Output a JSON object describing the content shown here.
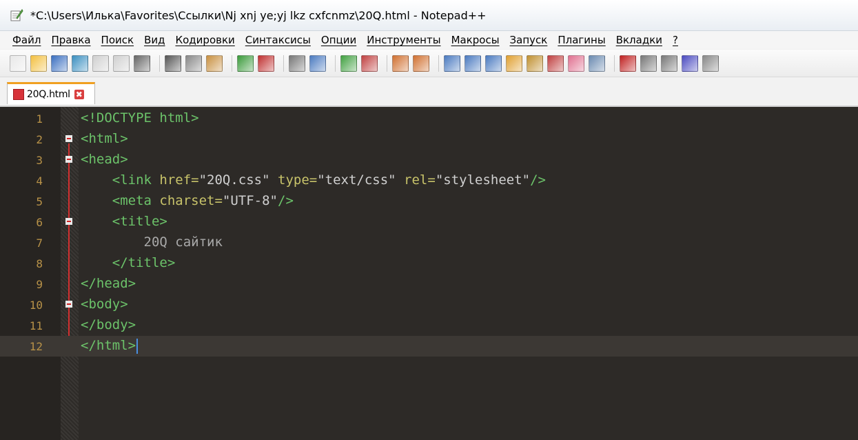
{
  "window": {
    "title": "*C:\\Users\\Илька\\Favorites\\Ссылки\\Nj xnj ye;yj lkz cxfcnmz\\20Q.html - Notepad++"
  },
  "menu": [
    "Файл",
    "Правка",
    "Поиск",
    "Вид",
    "Кодировки",
    "Синтаксисы",
    "Опции",
    "Инструменты",
    "Макросы",
    "Запуск",
    "Плагины",
    "Вкладки",
    "?"
  ],
  "toolbar_icons": [
    "new-file-icon",
    "open-file-icon",
    "save-icon",
    "save-all-icon",
    "close-icon",
    "close-all-icon",
    "print-icon",
    "cut-icon",
    "copy-icon",
    "paste-icon",
    "undo-icon",
    "redo-icon",
    "find-icon",
    "replace-icon",
    "zoom-in-icon",
    "zoom-out-icon",
    "sync-vertical-icon",
    "sync-horizontal-icon",
    "word-wrap-icon",
    "show-all-chars-icon",
    "indent-guide-icon",
    "udl-icon",
    "doc-map-icon",
    "function-list-icon",
    "folder-workspace-icon",
    "monitor-icon",
    "record-macro-icon",
    "stop-macro-icon",
    "play-macro-icon",
    "run-macro-multiple-icon",
    "save-macro-icon"
  ],
  "tab": {
    "label": "20Q.html",
    "close": "✖"
  },
  "editor": {
    "lines": [
      {
        "num": "1",
        "fold": false,
        "parts": [
          [
            "tag",
            "<!DOCTYPE html>"
          ]
        ]
      },
      {
        "num": "2",
        "fold": true,
        "parts": [
          [
            "tag",
            "<html>"
          ]
        ]
      },
      {
        "num": "3",
        "fold": true,
        "parts": [
          [
            "tag",
            "<head>"
          ]
        ]
      },
      {
        "num": "4",
        "fold": false,
        "parts": [
          [
            "txt",
            "    "
          ],
          [
            "tag",
            "<link "
          ],
          [
            "attr",
            "href="
          ],
          [
            "val",
            "\"20Q.css\" "
          ],
          [
            "attr",
            "type="
          ],
          [
            "val",
            "\"text/css\" "
          ],
          [
            "attr",
            "rel="
          ],
          [
            "val",
            "\"stylesheet\""
          ],
          [
            "tag",
            "/>"
          ]
        ]
      },
      {
        "num": "5",
        "fold": false,
        "parts": [
          [
            "txt",
            "    "
          ],
          [
            "tag",
            "<meta "
          ],
          [
            "attr",
            "charset="
          ],
          [
            "val",
            "\"UTF-8\""
          ],
          [
            "tag",
            "/>"
          ]
        ]
      },
      {
        "num": "6",
        "fold": true,
        "parts": [
          [
            "txt",
            "    "
          ],
          [
            "tag",
            "<title>"
          ]
        ]
      },
      {
        "num": "7",
        "fold": false,
        "parts": [
          [
            "txt",
            "        20Q сайтик"
          ]
        ]
      },
      {
        "num": "8",
        "fold": false,
        "parts": [
          [
            "txt",
            "    "
          ],
          [
            "tag",
            "</title>"
          ]
        ]
      },
      {
        "num": "9",
        "fold": false,
        "parts": [
          [
            "tag",
            "</head>"
          ]
        ]
      },
      {
        "num": "10",
        "fold": true,
        "parts": [
          [
            "tag",
            "<body>"
          ]
        ]
      },
      {
        "num": "11",
        "fold": false,
        "parts": [
          [
            "tag",
            "</body>"
          ]
        ]
      },
      {
        "num": "12",
        "fold": false,
        "current": true,
        "parts": [
          [
            "tag",
            "</html>"
          ]
        ]
      }
    ]
  },
  "colors": {
    "tag": "#6cc36a",
    "attr": "#c8c36a",
    "value": "#d0d0d0",
    "text": "#a9a9a9",
    "line_number": "#b89248",
    "background": "#2d2a27"
  }
}
